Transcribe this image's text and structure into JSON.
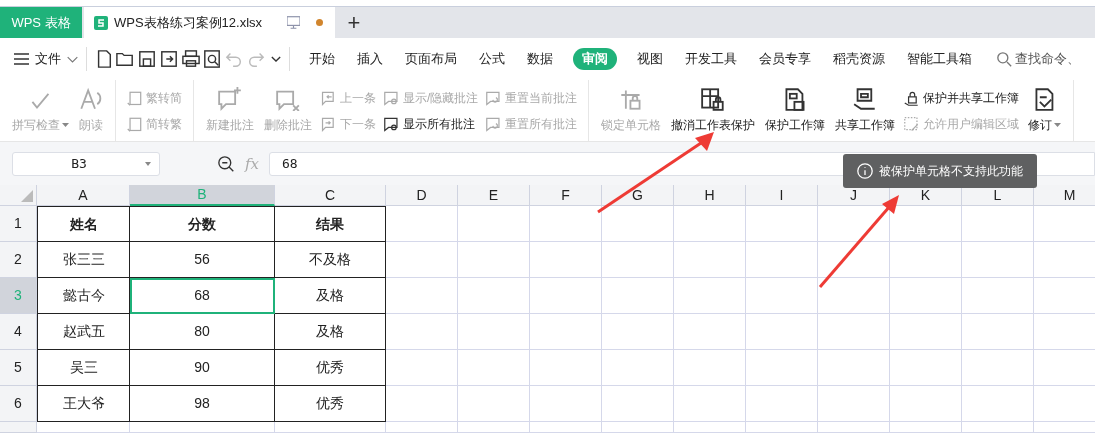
{
  "app_tab": {
    "label": "WPS 表格"
  },
  "document_tabs": [
    {
      "label": "WPS表格练习案例12.xlsx",
      "selected": true,
      "unsaved": true
    }
  ],
  "new_tab": {
    "label": "+"
  },
  "file_menu": {
    "label": "文件"
  },
  "menu_tabs": [
    {
      "label": "开始",
      "selected": false
    },
    {
      "label": "插入",
      "selected": false
    },
    {
      "label": "页面布局",
      "selected": false
    },
    {
      "label": "公式",
      "selected": false
    },
    {
      "label": "数据",
      "selected": false
    },
    {
      "label": "审阅",
      "selected": true
    },
    {
      "label": "视图",
      "selected": false
    },
    {
      "label": "开发工具",
      "selected": false
    },
    {
      "label": "会员专享",
      "selected": false
    },
    {
      "label": "稻壳资源",
      "selected": false
    },
    {
      "label": "智能工具箱",
      "selected": false
    }
  ],
  "search": {
    "placeholder": "查找命令、"
  },
  "ribbon_groups": [
    {
      "items": [
        {
          "kind": "large",
          "label": "拼写检查",
          "disabled": true,
          "dropdown": true
        },
        {
          "kind": "large",
          "label": "朗读",
          "disabled": true,
          "dropdown": false
        }
      ]
    },
    {
      "items": [
        {
          "kind": "stack",
          "buttons": [
            {
              "label": "繁转简",
              "disabled": true
            },
            {
              "label": "简转繁",
              "disabled": true
            }
          ]
        }
      ]
    },
    {
      "items": [
        {
          "kind": "large",
          "label": "新建批注",
          "disabled": true,
          "dropdown": false
        },
        {
          "kind": "large",
          "label": "删除批注",
          "disabled": true,
          "dropdown": false
        },
        {
          "kind": "stack",
          "buttons": [
            {
              "label": "上一条",
              "disabled": true
            },
            {
              "label": "下一条",
              "disabled": true
            }
          ]
        },
        {
          "kind": "stack",
          "buttons": [
            {
              "label": "显示/隐藏批注",
              "disabled": true
            },
            {
              "label": "显示所有批注",
              "disabled": false
            }
          ]
        },
        {
          "kind": "stack",
          "buttons": [
            {
              "label": "重置当前批注",
              "disabled": true
            },
            {
              "label": "重置所有批注",
              "disabled": true
            }
          ]
        }
      ]
    },
    {
      "items": [
        {
          "kind": "large",
          "label": "锁定单元格",
          "disabled": true,
          "dropdown": false
        },
        {
          "kind": "large",
          "label": "撤消工作表保护",
          "disabled": false,
          "dropdown": false
        },
        {
          "kind": "large",
          "label": "保护工作簿",
          "disabled": false,
          "dropdown": false
        },
        {
          "kind": "large",
          "label": "共享工作簿",
          "disabled": false,
          "dropdown": false
        },
        {
          "kind": "stack",
          "buttons": [
            {
              "label": "保护并共享工作簿",
              "disabled": false
            },
            {
              "label": "允许用户编辑区域",
              "disabled": true
            }
          ]
        },
        {
          "kind": "large",
          "label": "修订",
          "disabled": false,
          "dropdown": true
        }
      ]
    }
  ],
  "name_box": {
    "value": "B3"
  },
  "formula_bar": {
    "fx": "fx",
    "value": "68"
  },
  "toast": {
    "text": "被保护单元格不支持此功能"
  },
  "columns": [
    {
      "label": "A",
      "selected": false
    },
    {
      "label": "B",
      "selected": true
    },
    {
      "label": "C",
      "selected": false
    },
    {
      "label": "D",
      "selected": false
    },
    {
      "label": "E",
      "selected": false
    },
    {
      "label": "F",
      "selected": false
    },
    {
      "label": "G",
      "selected": false
    },
    {
      "label": "H",
      "selected": false
    },
    {
      "label": "I",
      "selected": false
    },
    {
      "label": "J",
      "selected": false
    },
    {
      "label": "K",
      "selected": false
    },
    {
      "label": "L",
      "selected": false
    },
    {
      "label": "M",
      "selected": false
    }
  ],
  "rows": [
    {
      "label": "1",
      "kind": "header",
      "selected": false,
      "cells": [
        {
          "text": "姓名",
          "selected": false
        },
        {
          "text": "分数",
          "selected": false
        },
        {
          "text": "结果",
          "selected": false
        }
      ]
    },
    {
      "label": "2",
      "kind": "data",
      "selected": false,
      "cells": [
        {
          "text": "张三三",
          "selected": false
        },
        {
          "text": "56",
          "selected": false
        },
        {
          "text": "不及格",
          "selected": false
        }
      ]
    },
    {
      "label": "3",
      "kind": "data",
      "selected": true,
      "cells": [
        {
          "text": "懿古今",
          "selected": false
        },
        {
          "text": "68",
          "selected": true
        },
        {
          "text": "及格",
          "selected": false
        }
      ]
    },
    {
      "label": "4",
      "kind": "data",
      "selected": false,
      "cells": [
        {
          "text": "赵武五",
          "selected": false
        },
        {
          "text": "80",
          "selected": false
        },
        {
          "text": "及格",
          "selected": false
        }
      ]
    },
    {
      "label": "5",
      "kind": "data",
      "selected": false,
      "cells": [
        {
          "text": "吴三",
          "selected": false
        },
        {
          "text": "90",
          "selected": false
        },
        {
          "text": "优秀",
          "selected": false
        }
      ]
    },
    {
      "label": "6",
      "kind": "data",
      "selected": false,
      "cells": [
        {
          "text": "王大爷",
          "selected": false
        },
        {
          "text": "98",
          "selected": false
        },
        {
          "text": "优秀",
          "selected": false
        }
      ]
    }
  ]
}
